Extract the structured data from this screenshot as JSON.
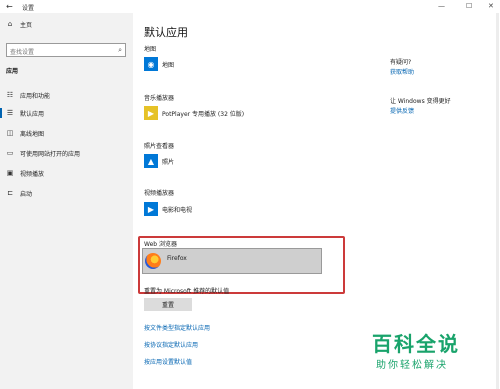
{
  "window": {
    "title": "设置",
    "back_icon": "←",
    "minimize": "—",
    "maximize": "☐",
    "close": "✕"
  },
  "sidebar": {
    "home_label": "主页",
    "home_icon": "⌂",
    "search_placeholder": "查找设置",
    "search_icon": "⌕",
    "section": "应用",
    "items": [
      {
        "label": "应用和功能",
        "icon": "☷"
      },
      {
        "label": "默认应用",
        "icon": "☰"
      },
      {
        "label": "离线地图",
        "icon": "◫"
      },
      {
        "label": "可使用网站打开的应用",
        "icon": "▭"
      },
      {
        "label": "视频播放",
        "icon": "▣"
      },
      {
        "label": "启动",
        "icon": "⊏"
      }
    ]
  },
  "main": {
    "title": "默认应用",
    "categories": [
      {
        "label": "地图",
        "app": "地图",
        "icon": "◉",
        "color": "#0078d7"
      },
      {
        "label": "音乐播放器",
        "app": "PotPlayer 专用播放 (32 位版)",
        "icon": "▶",
        "color": "#e6c227"
      },
      {
        "label": "照片查看器",
        "app": "照片",
        "icon": "▲",
        "color": "#0078d7"
      },
      {
        "label": "视频播放器",
        "app": "电影和电视",
        "icon": "▶",
        "color": "#0078d7"
      }
    ],
    "web_label": "Web 浏览器",
    "web_app": "Firefox",
    "reset_label": "重置为 Microsoft 推荐的默认值",
    "reset_button": "重置",
    "links": [
      "按文件类型指定默认应用",
      "按协议指定默认应用",
      "按应用设置默认值"
    ]
  },
  "right_panel": {
    "q1": "有疑问?",
    "q1_link": "获取帮助",
    "q2": "让 Windows 变得更好",
    "q2_link": "提供反馈"
  },
  "watermark": {
    "big": "百科全说",
    "small": "助你轻松解决"
  }
}
